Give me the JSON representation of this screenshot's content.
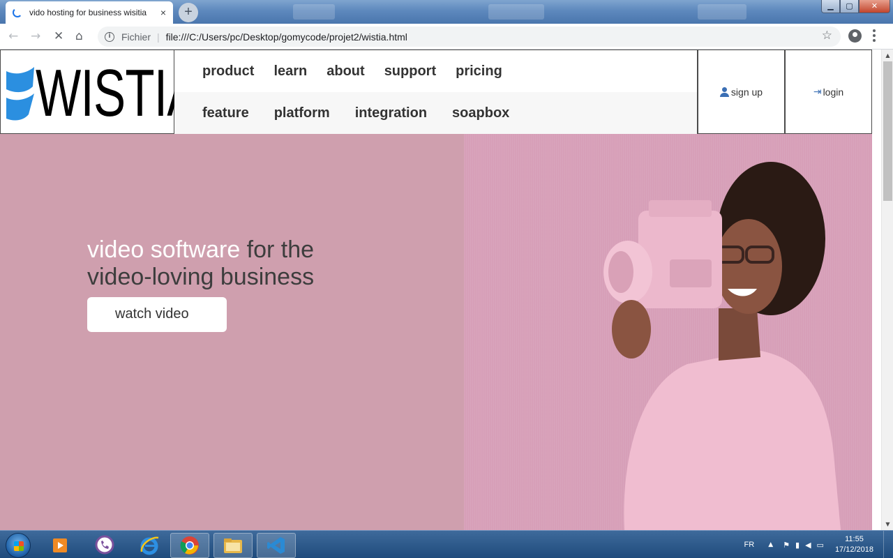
{
  "browser": {
    "tab_title": "vido hosting for business wisitia",
    "tab_close": "×",
    "new_tab": "+",
    "scheme_label": "Fichier",
    "url": "file:///C:/Users/pc/Desktop/gomycode/projet2/wistia.html",
    "window_controls": {
      "minimize": "▁",
      "maximize": "▢",
      "close": "✕"
    }
  },
  "site": {
    "logo_text": "WISTIA",
    "nav_row1": [
      "product",
      "learn",
      "about",
      "support",
      "pricing"
    ],
    "nav_row2": [
      "feature",
      "platform",
      "integration",
      "soapbox"
    ],
    "signup_label": "sign up",
    "login_label": "login",
    "hero": {
      "title_highlight": "video software",
      "title_rest_line1": " for the",
      "title_line2": "video-loving business",
      "cta_label": "watch video"
    }
  },
  "taskbar": {
    "language": "FR",
    "time": "11:55",
    "date": "17/12/2018",
    "apps": [
      "media-player",
      "viber",
      "internet-explorer",
      "chrome",
      "file-explorer",
      "vscode"
    ]
  },
  "colors": {
    "hero_bg": "#cf9fae",
    "hero_image_bg": "#d79fb8",
    "logo_blue": "#2b8fe0",
    "icon_blue": "#3b6fb4"
  }
}
